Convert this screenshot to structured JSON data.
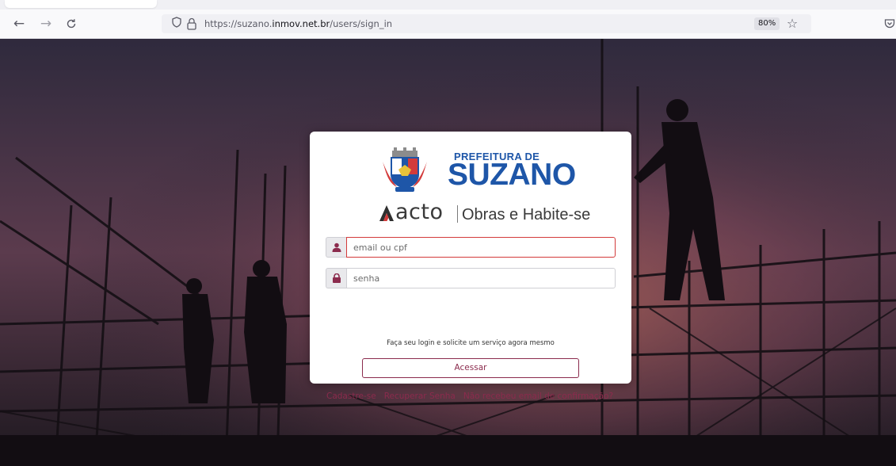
{
  "browser": {
    "url_prefix": "https://suzano.",
    "url_domain": "inmov.net.br",
    "url_path": "/users/sign_in",
    "zoom": "80%",
    "icons": {
      "back": "arrow-left-icon",
      "forward": "arrow-right-icon",
      "reload": "reload-icon",
      "tracking": "shield-icon",
      "lock": "lock-icon",
      "bookmark": "star-icon",
      "pocket": "pocket-icon"
    }
  },
  "login": {
    "logo": {
      "top_text": "PREFEITURA DE",
      "main_text": "SUZANO",
      "brand_color": "#1e56a8"
    },
    "acto": {
      "word": "acto",
      "subtitle": "Obras e Habite-se"
    },
    "email": {
      "placeholder": "email ou cpf",
      "value": "",
      "icon": "user-icon",
      "invalid_border": "#d33b3b"
    },
    "password": {
      "placeholder": "senha",
      "value": "",
      "icon": "lock-icon"
    },
    "hint": "Faça seu login e solicite um serviço agora mesmo",
    "submit_label": "Acessar",
    "accent_color": "#8b2b4d",
    "links": {
      "register": "Cadastre-se",
      "recover": "Recuperar Senha",
      "resend": "Não recebeu email de confirmação?"
    }
  }
}
